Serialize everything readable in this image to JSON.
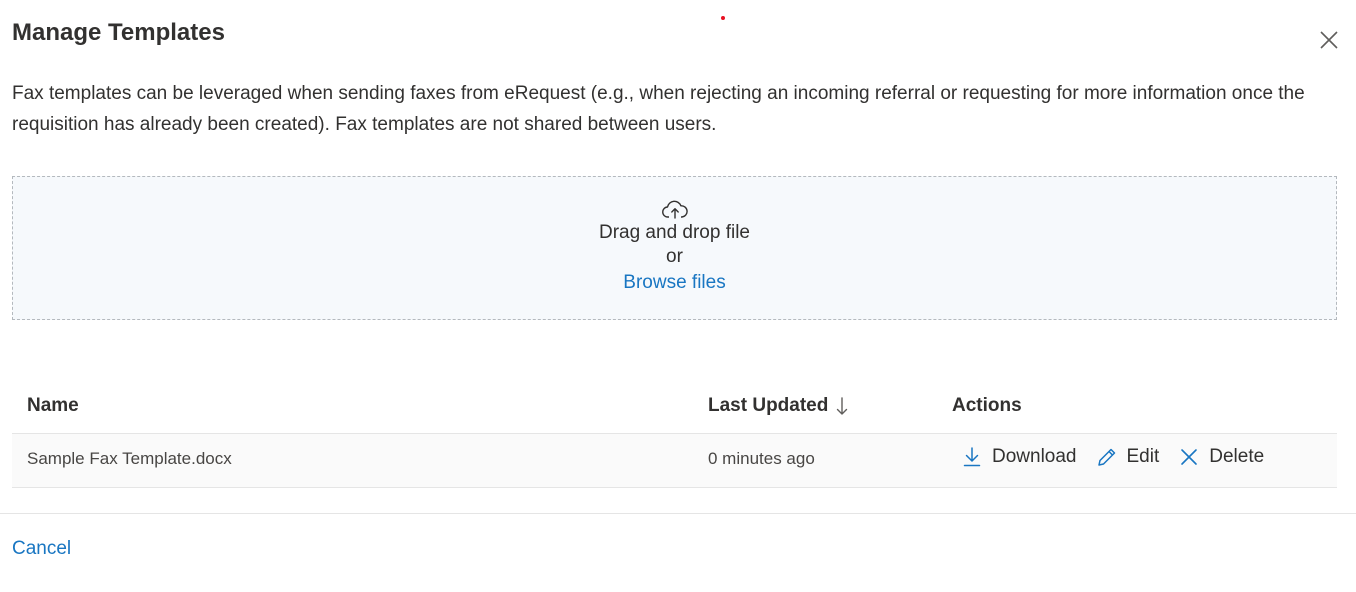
{
  "dialog": {
    "title": "Manage Templates",
    "description": "Fax templates can be leveraged when sending faxes from eRequest (e.g., when rejecting an incoming referral or requesting for more information once the requisition has already been created). Fax templates are not shared between users."
  },
  "dropzone": {
    "icon": "cloud-upload-icon",
    "drag_text": "Drag and drop file",
    "or_text": "or",
    "browse_label": "Browse files"
  },
  "table": {
    "columns": {
      "name": "Name",
      "last_updated": "Last Updated",
      "actions": "Actions"
    },
    "sort": {
      "column": "last_updated",
      "direction": "descending",
      "icon": "arrow-down-icon"
    },
    "rows": [
      {
        "name": "Sample Fax Template.docx",
        "last_updated": "0 minutes ago",
        "actions": {
          "download": "Download",
          "edit": "Edit",
          "delete": "Delete"
        }
      }
    ]
  },
  "footer": {
    "cancel_label": "Cancel"
  },
  "colors": {
    "link": "#1976c2",
    "text": "#323130",
    "dropzone_bg": "#f6f9fc",
    "dropzone_border": "#b4b9be",
    "indicator_dot": "#e81123"
  }
}
